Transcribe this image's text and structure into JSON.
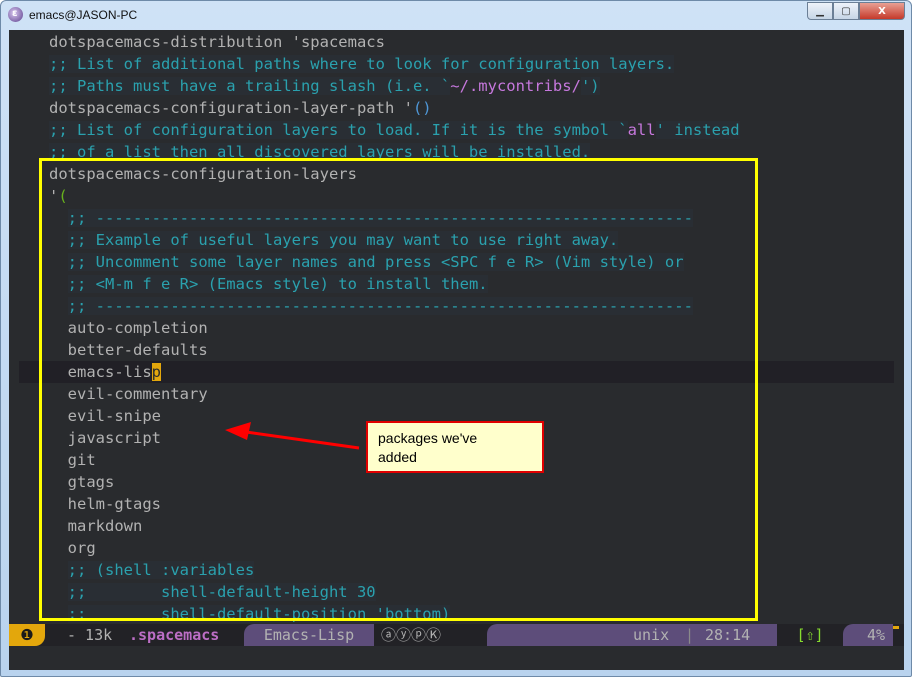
{
  "window": {
    "title": "emacs@JASON-PC",
    "buttons": {
      "minimize": "▁",
      "maximize": "▢",
      "close": "X"
    }
  },
  "editor": {
    "lines": [
      {
        "indent": "  ",
        "parts": [
          {
            "t": "dotspacemacs-distribution 'spacemacs",
            "c": ""
          }
        ]
      },
      {
        "indent": "  ",
        "parts": [
          {
            "t": ";; List of additional paths where to look for configuration layers.",
            "c": "cm"
          }
        ]
      },
      {
        "indent": "  ",
        "parts": [
          {
            "t": ";; Paths must have a trailing slash (i.e. `",
            "c": "cm"
          },
          {
            "t": "~/.mycontribs/",
            "c": "str"
          },
          {
            "t": "')",
            "c": "cm"
          }
        ]
      },
      {
        "indent": "  ",
        "parts": [
          {
            "t": "dotspacemacs-configuration-layer-path '",
            "c": ""
          },
          {
            "t": "()",
            "c": "paren"
          }
        ]
      },
      {
        "indent": "  ",
        "parts": [
          {
            "t": ";; List of configuration layers to load. If it is the symbol `",
            "c": "cm"
          },
          {
            "t": "all",
            "c": "str"
          },
          {
            "t": "' instead",
            "c": "cm"
          }
        ]
      },
      {
        "indent": "  ",
        "parts": [
          {
            "t": ";; of a list then all discovered layers will be installed.",
            "c": "cm"
          }
        ]
      },
      {
        "indent": "  ",
        "parts": [
          {
            "t": "dotspacemacs-configuration-layers",
            "c": ""
          }
        ]
      },
      {
        "indent": "  ",
        "parts": [
          {
            "t": "'",
            "c": ""
          },
          {
            "t": "(",
            "c": "paren-g"
          }
        ]
      },
      {
        "indent": "    ",
        "parts": [
          {
            "t": ";; ----------------------------------------------------------------",
            "c": "cm"
          }
        ]
      },
      {
        "indent": "    ",
        "parts": [
          {
            "t": ";; Example of useful layers you may want to use right away.",
            "c": "cm"
          }
        ]
      },
      {
        "indent": "    ",
        "parts": [
          {
            "t": ";; Uncomment some layer names and press <SPC f e R> (Vim style) or",
            "c": "cm"
          }
        ]
      },
      {
        "indent": "    ",
        "parts": [
          {
            "t": ";; <M-m f e R> (Emacs style) to install them.",
            "c": "cm"
          }
        ]
      },
      {
        "indent": "    ",
        "parts": [
          {
            "t": ";; ----------------------------------------------------------------",
            "c": "cm"
          }
        ]
      },
      {
        "indent": "    ",
        "parts": [
          {
            "t": "auto-completion",
            "c": ""
          }
        ]
      },
      {
        "indent": "    ",
        "parts": [
          {
            "t": "better-defaults",
            "c": ""
          }
        ]
      },
      {
        "indent": "    ",
        "parts": [
          {
            "t": "emacs-lis",
            "c": ""
          },
          {
            "t": "p",
            "c": "cursor"
          }
        ],
        "current": true
      },
      {
        "indent": "    ",
        "parts": [
          {
            "t": "evil-commentary",
            "c": ""
          }
        ]
      },
      {
        "indent": "    ",
        "parts": [
          {
            "t": "evil-snipe",
            "c": ""
          }
        ]
      },
      {
        "indent": "    ",
        "parts": [
          {
            "t": "javascript",
            "c": ""
          }
        ]
      },
      {
        "indent": "    ",
        "parts": [
          {
            "t": "git",
            "c": ""
          }
        ]
      },
      {
        "indent": "    ",
        "parts": [
          {
            "t": "gtags",
            "c": ""
          }
        ]
      },
      {
        "indent": "    ",
        "parts": [
          {
            "t": "helm-gtags",
            "c": ""
          }
        ]
      },
      {
        "indent": "    ",
        "parts": [
          {
            "t": "markdown",
            "c": ""
          }
        ]
      },
      {
        "indent": "    ",
        "parts": [
          {
            "t": "org",
            "c": ""
          }
        ]
      },
      {
        "indent": "    ",
        "parts": [
          {
            "t": ";; (shell :variables",
            "c": "cm"
          }
        ]
      },
      {
        "indent": "    ",
        "parts": [
          {
            "t": ";;        shell-default-height 30",
            "c": "cm"
          }
        ]
      },
      {
        "indent": "    ",
        "parts": [
          {
            "t": ";;        shell-default-position 'bottom)",
            "c": "cm"
          }
        ]
      }
    ]
  },
  "annotation": {
    "callout_text_line1": "packages we've",
    "callout_text_line2": "added",
    "box_color": "#ffff00",
    "arrow_color": "#ff0000"
  },
  "modeline": {
    "window_number": "❶",
    "buffer_size": "- 13k",
    "buffer_name": ".spacemacs",
    "major_mode": "Emacs-Lisp",
    "minor_modes": "ⓐⓨⓟⓀ",
    "encoding": "unix",
    "separator": "|",
    "position": "28:14",
    "evil_state": "[⇧]",
    "scroll_percent": "4%",
    "colors": {
      "window_number_bg": "#e3a70c",
      "buffer_name": "#bc6ec5",
      "active_bg": "#5d4d7a",
      "evil_state": "#86dc2f"
    }
  }
}
